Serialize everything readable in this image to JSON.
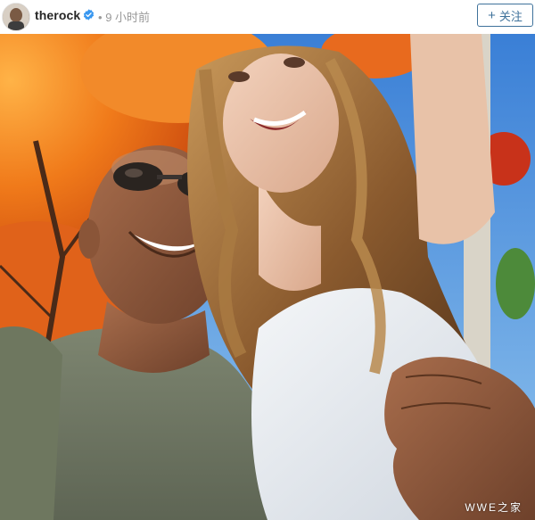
{
  "post": {
    "username": "therock",
    "time": "9 小时前",
    "separator": "•"
  },
  "header": {
    "follow_label": "关注",
    "follow_icon": "plus-icon",
    "verified_icon": "verified-badge-icon"
  },
  "photo": {
    "subject": "selfie-photo",
    "watermark": "WWE之家"
  },
  "colors": {
    "accent": "#3f729b",
    "verified": "#3897f0",
    "meta_gray": "#999999",
    "username": "#262626"
  }
}
